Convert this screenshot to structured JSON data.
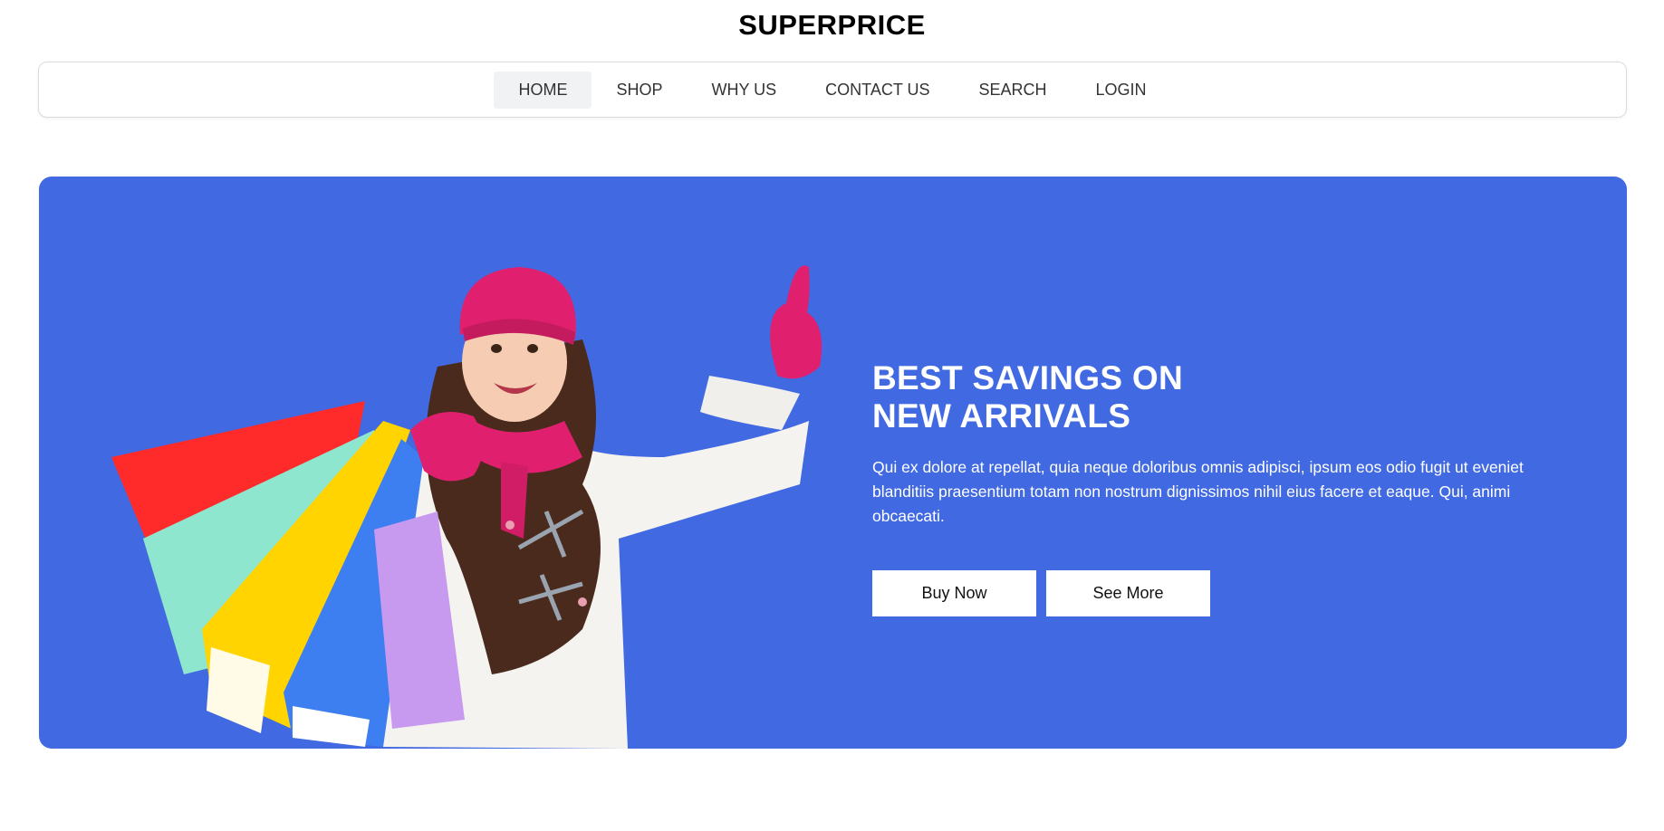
{
  "header": {
    "site_title": "SUPERPRICE"
  },
  "nav": {
    "items": [
      {
        "label": "HOME",
        "active": true
      },
      {
        "label": "SHOP"
      },
      {
        "label": "WHY US"
      },
      {
        "label": "CONTACT US"
      },
      {
        "label": "SEARCH"
      },
      {
        "label": "LOGIN"
      }
    ]
  },
  "hero": {
    "headline_line1": "BEST SAVINGS ON",
    "headline_line2": "NEW ARRIVALS",
    "body": "Qui ex dolore at repellat, quia neque doloribus omnis adipisci, ipsum eos odio fugit ut eveniet blanditiis praesentium totam non nostrum dignissimos nihil eius facere et eaque. Qui, animi obcaecati.",
    "buy_label": "Buy Now",
    "more_label": "See More",
    "image_icon": "shopping-girl-illustration"
  },
  "colors": {
    "hero_bg": "#4169e1",
    "hat": "#e0206e",
    "sweater": "#f5f3f0",
    "bag_red": "#ff2a2a",
    "bag_mint": "#8fe6cf",
    "bag_yellow": "#ffd400",
    "bag_blue": "#3d7ff0",
    "bag_lilac": "#c79af0"
  }
}
